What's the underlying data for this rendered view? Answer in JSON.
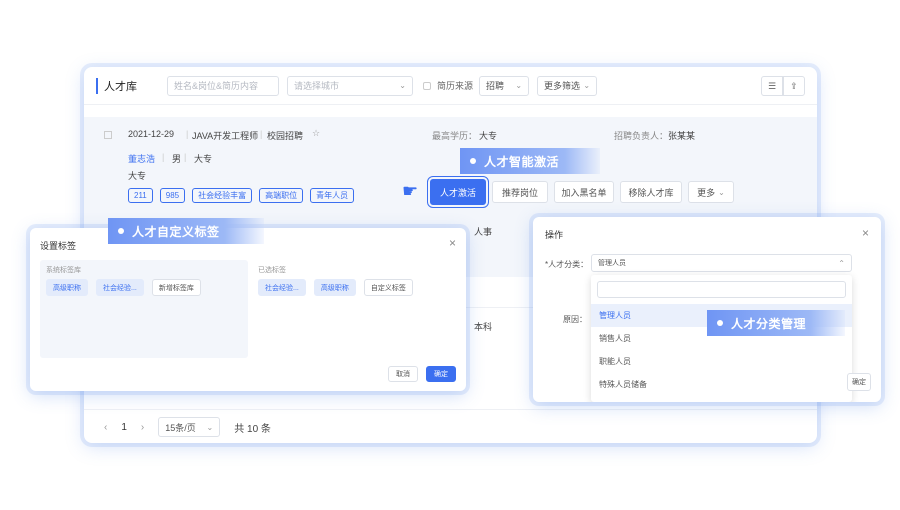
{
  "main": {
    "title": "人才库",
    "search_placeholder": "姓名&岗位&简历内容",
    "location_placeholder": "请选择城市",
    "filter_label": "简历来源",
    "filter_value": "招聘",
    "advanced_filter": "更多筛选",
    "toolbar_icons": [
      "list-icon",
      "export-icon"
    ],
    "row1": {
      "date": "2021-12-29",
      "job": "JAVA开发工程师",
      "source": "校园招聘",
      "edu_label": "最高学历：",
      "edu_value": "大专",
      "owner_label": "招聘负责人：",
      "owner_value": "张某某",
      "name": "董志浩",
      "gender": "男",
      "education": "大专",
      "edu2": "大专",
      "tags": [
        "211",
        "985",
        "社会经验丰富",
        "高端职位",
        "青年人员"
      ]
    },
    "row2_owner_value": "人事",
    "row3_owner_value": "本科",
    "actions": [
      "人才激活",
      "推荐岗位",
      "加入黑名单",
      "移除人才库",
      "更多"
    ],
    "pagination": {
      "current": "1",
      "page_size": "15条/页",
      "total": "共 10 条"
    }
  },
  "callouts": {
    "activation": "人才智能激活",
    "custom_tags": "人才自定义标签",
    "classification": "人才分类管理"
  },
  "tag_dialog": {
    "title": "设置标签",
    "system_label": "系统标签库",
    "system_tags": [
      "高级职称",
      "社会经验...",
      "新增标签库"
    ],
    "custom_label": "已选标签",
    "custom_tags": [
      "社会经验...",
      "高级职称",
      "自定义标签"
    ],
    "cancel": "取消",
    "confirm": "确定"
  },
  "op_dialog": {
    "title": "操作",
    "category_label": "*人才分类：",
    "category_value": "管理人员",
    "reason_label": "原因：",
    "options": [
      "管理人员",
      "销售人员",
      "职能人员",
      "特殊人员储备"
    ],
    "side_button": "确定"
  },
  "colors": {
    "accent": "#3b6ff0",
    "callout": "#7b9df4"
  }
}
